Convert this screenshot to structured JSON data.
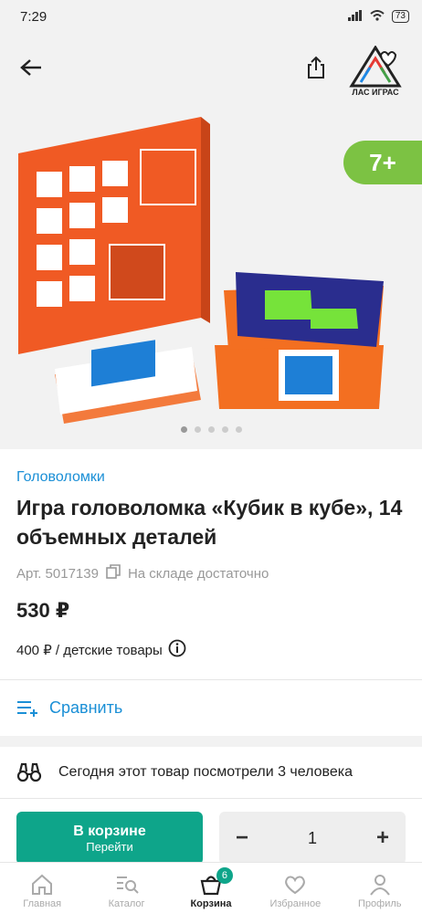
{
  "status": {
    "time": "7:29",
    "battery": "73"
  },
  "brand": {
    "name": "ЛАС ИГРАС"
  },
  "age": "7+",
  "gallery": {
    "total": 5,
    "active": 0
  },
  "product": {
    "category": "Головоломки",
    "title": "Игра головоломка «Кубик в кубе», 14 объемных деталей",
    "article": "Арт. 5017139",
    "stock": "На складе достаточно",
    "price": "530 ₽",
    "subprice": "400 ₽ / детские товары"
  },
  "compare_label": "Сравнить",
  "viewers_text": "Сегодня этот товар посмотрели 3 человека",
  "actions": {
    "cart_label": "В корзине",
    "cart_sub": "Перейти",
    "minus": "−",
    "qty": "1",
    "plus": "+"
  },
  "tabs": [
    {
      "label": "Главная",
      "icon": "home-icon"
    },
    {
      "label": "Каталог",
      "icon": "catalog-icon"
    },
    {
      "label": "Корзина",
      "icon": "cart-icon",
      "badge": "6",
      "active": true
    },
    {
      "label": "Избранное",
      "icon": "heart-icon"
    },
    {
      "label": "Профиль",
      "icon": "user-icon"
    }
  ],
  "colors": {
    "accent": "#0ea58a",
    "link": "#1a8fd6",
    "age_badge": "#7cc243",
    "product_orange": "#f05a24"
  }
}
